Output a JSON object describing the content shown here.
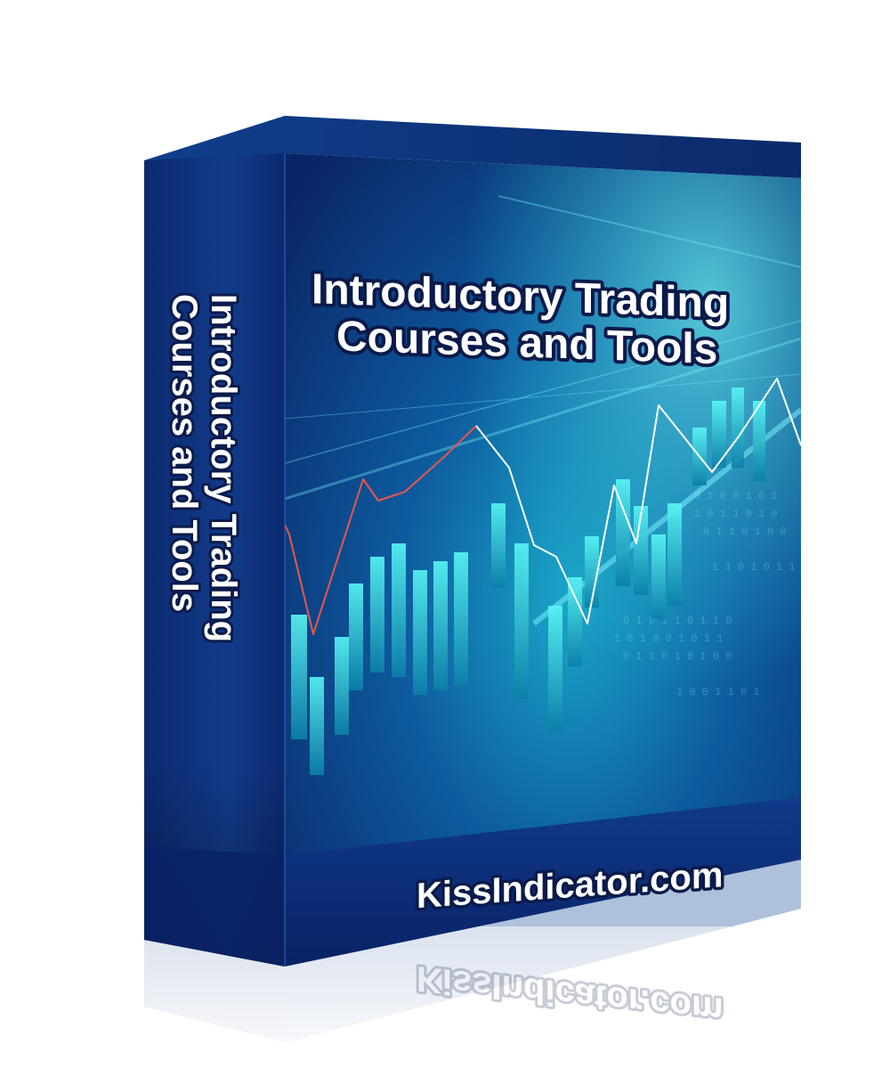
{
  "product": {
    "title_line1": "Introductory Trading",
    "title_line2": "Courses and Tools",
    "spine_line1": "Introductory Trading",
    "spine_line2": "Courses and Tools",
    "website": "KissIndicator.com"
  },
  "colors": {
    "box_dark": "#0a1f5c",
    "box_mid": "#103a86",
    "cyan": "#22d8e0",
    "teal": "#0a6b86",
    "line_red": "#e8574c",
    "line_white": "#ffffff",
    "outline": "#0a1a4a"
  }
}
